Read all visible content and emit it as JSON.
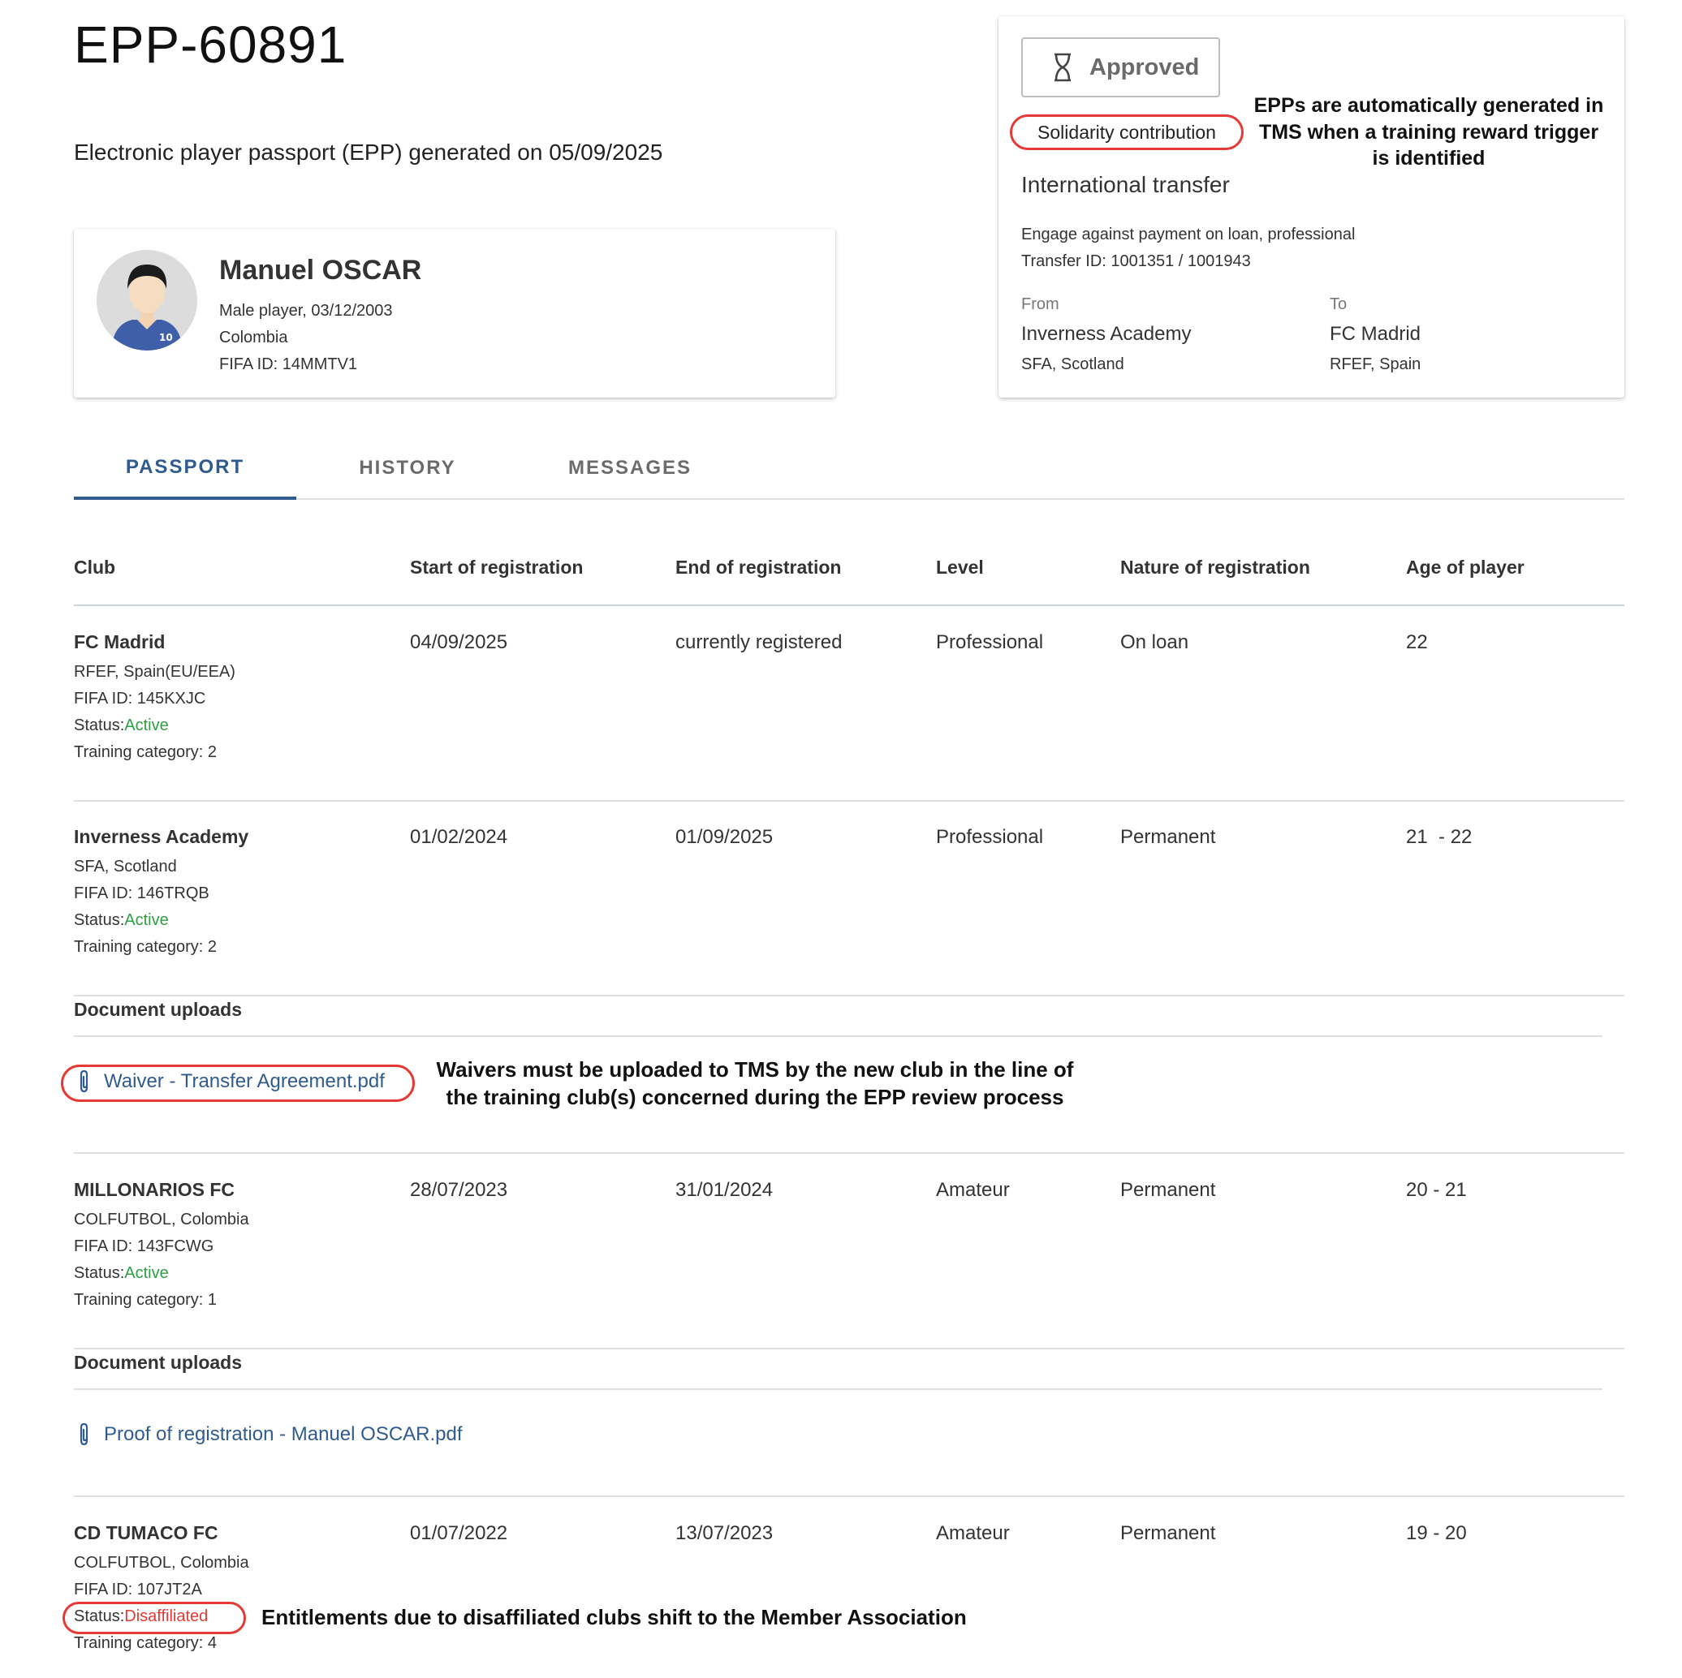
{
  "header": {
    "epp_id": "EPP-60891",
    "subtitle": "Electronic player passport (EPP) generated on 05/09/2025"
  },
  "player": {
    "name": "Manuel OSCAR",
    "line1": "Male player, 03/12/2003",
    "line2": "Colombia",
    "line3": "FIFA ID: 14MMTV1",
    "jersey_number": "10"
  },
  "transfer_card": {
    "status": "Approved",
    "status_icon": "hourglass-icon",
    "type_badge": "Solidarity contribution",
    "annotation": "EPPs are automatically generated in TMS when a training reward trigger is identified",
    "transfer_kind": "International transfer",
    "description": "Engage against payment on loan, professional",
    "transfer_id": "Transfer ID: 1001351 / 1001943",
    "from_label": "From",
    "from_club": "Inverness Academy",
    "from_assoc": "SFA, Scotland",
    "to_label": "To",
    "to_club": "FC Madrid",
    "to_assoc": "RFEF, Spain"
  },
  "tabs": [
    {
      "label": "PASSPORT",
      "active": true
    },
    {
      "label": "HISTORY",
      "active": false
    },
    {
      "label": "MESSAGES",
      "active": false
    }
  ],
  "table": {
    "columns": [
      "Club",
      "Start of registration",
      "End of registration",
      "Level",
      "Nature of registration",
      "Age of player"
    ],
    "rows": [
      {
        "club": "FC Madrid",
        "assoc": "RFEF, Spain(EU/EEA)",
        "fifa_id": "FIFA ID: 145KXJC",
        "status_prefix": "Status:",
        "status": "Active",
        "training": "Training category: 2",
        "start": "04/09/2025",
        "end": "currently registered",
        "level": "Professional",
        "nature": "On loan",
        "age": "22"
      },
      {
        "club": "Inverness Academy",
        "assoc": "SFA, Scotland",
        "fifa_id": "FIFA ID: 146TRQB",
        "status_prefix": "Status:",
        "status": "Active",
        "training": "Training category: 2",
        "start": "01/02/2024",
        "end": "01/09/2025",
        "level": "Professional",
        "nature": "Permanent",
        "age": "21  - 22",
        "documents_header": "Document uploads",
        "document": "Waiver - Transfer Agreement.pdf",
        "annotation": "Waivers must be uploaded to TMS by the new club in the line of the training club(s) concerned during the EPP review process"
      },
      {
        "club": "MILLONARIOS FC",
        "assoc": "COLFUTBOL, Colombia",
        "fifa_id": "FIFA ID: 143FCWG",
        "status_prefix": "Status:",
        "status": "Active",
        "training": "Training category: 1",
        "start": "28/07/2023",
        "end": "31/01/2024",
        "level": "Amateur",
        "nature": "Permanent",
        "age": "20 - 21",
        "documents_header": "Document uploads",
        "document": "Proof of registration - Manuel OSCAR.pdf"
      },
      {
        "club": "CD TUMACO FC",
        "assoc": "COLFUTBOL, Colombia",
        "fifa_id": "FIFA ID: 107JT2A",
        "status_prefix": "Status:",
        "status": "Disaffiliated",
        "training": "Training category: 4",
        "start": "01/07/2022",
        "end": "13/07/2023",
        "level": "Amateur",
        "nature": "Permanent",
        "age": "19 - 20",
        "annotation": "Entitlements due to disaffiliated clubs shift to the Member Association"
      }
    ]
  },
  "colors": {
    "accent": "#2f5b8f",
    "active_status": "#2ea043",
    "disaffiliated_status": "#e53935",
    "highlight_oval": "#e53935"
  }
}
